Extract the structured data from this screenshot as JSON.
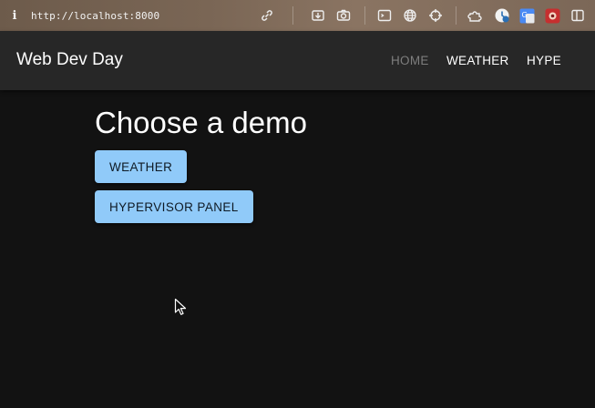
{
  "browser": {
    "url": "http://localhost:8000",
    "icons": [
      "info-icon",
      "link-icon",
      "download-icon",
      "camera-icon",
      "terminal-icon",
      "globe-icon",
      "crosshair-icon",
      "puzzle-icon",
      "clock-icon",
      "translate-icon",
      "extension-icon",
      "sidebar-icon"
    ]
  },
  "header": {
    "title": "Web Dev Day",
    "nav": [
      {
        "label": "HOME",
        "active": true
      },
      {
        "label": "WEATHER",
        "active": false
      },
      {
        "label": "HYPE",
        "active": false
      }
    ]
  },
  "main": {
    "heading": "Choose a demo",
    "buttons": [
      {
        "label": "WEATHER"
      },
      {
        "label": "HYPERVISOR PANEL"
      }
    ]
  },
  "colors": {
    "background": "#121212",
    "app_bar": "#272727",
    "button": "#90caf9",
    "inactive_nav": "#7e7e7e"
  }
}
